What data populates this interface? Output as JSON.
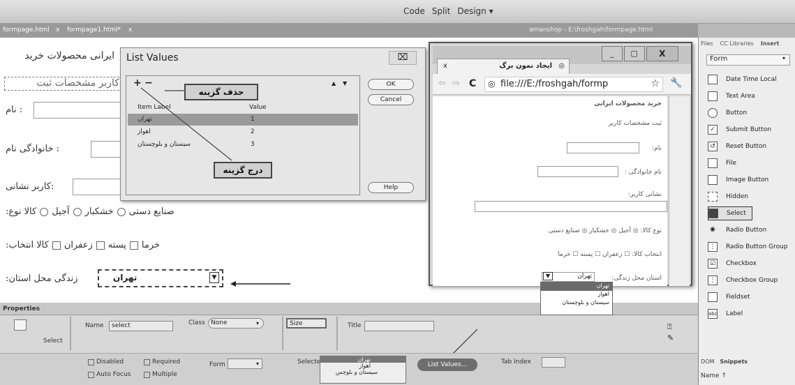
{
  "toolbar": {
    "code": "Code",
    "split": "Split",
    "design": "Design ▾"
  },
  "tabs": {
    "tab1": "formpage.html",
    "tab2": "formpage1.html*",
    "close": "x",
    "path": "amanshop - E:\\froshgah\\formpage.html"
  },
  "page": {
    "title": "ایرانی محصولات خرید",
    "subtitle": "کاربر مشخصات ثبت",
    "name_label": ": نام",
    "family_label": ": خانوادگی نام",
    "address_label": ":کاربر نشانی",
    "radio_label": ":کالا نوع",
    "radio_opts": [
      "آجیل",
      "خشکبار",
      "صنایع دستی"
    ],
    "check_label": ":کالا انتخاب",
    "check_opts": [
      "زعفران",
      "پسته",
      "خرما"
    ],
    "province_label": ":زندگی محل استان",
    "select_value": "تهران"
  },
  "dialog": {
    "title": "List Values",
    "close": "⌧",
    "plus": "+",
    "minus": "−",
    "up": "▲",
    "down": "▼",
    "col_label": "Item Label",
    "col_value": "Value",
    "rows": [
      {
        "label": "تهران",
        "value": "1"
      },
      {
        "label": "اهواز",
        "value": "2"
      },
      {
        "label": "سیستان و بلوچستان",
        "value": "3"
      }
    ],
    "ok": "OK",
    "cancel": "Cancel",
    "help": "Help"
  },
  "callouts": {
    "remove": "حذف گزینه",
    "insert": "درج گزینه"
  },
  "browser": {
    "tab_title": "ایجاد نمون برگ",
    "tab_close": "x",
    "url": "file:///E:/froshgah/formp",
    "title": "خرید محصولات ایرانی",
    "subtitle": "ثبت مشخصات کاربر",
    "name": "نام:",
    "family": "نام خانوادگی :",
    "address": "نشانی کاربر:",
    "kind": "نوع کالا: ◎ آجیل ◎ خشکبار ◎ صنایع دستی",
    "choose": "انتخاب کالا: ☐ زعفران ☐ پسته ☐ خرما",
    "province": "استان محل زندگی:",
    "select": "تهران",
    "opts": [
      "تهران",
      "اهواز",
      "سیستان و بلوچستان"
    ]
  },
  "insert_panel": {
    "tabs": [
      "Files",
      "CC Libraries",
      "Insert"
    ],
    "category": "Form",
    "items": [
      "Date Time Local",
      "Text Area",
      "Button",
      "Submit Button",
      "Reset Button",
      "File",
      "Image Button",
      "Hidden",
      "Select",
      "Radio Button",
      "Radio Button Group",
      "Checkbox",
      "Checkbox Group",
      "Fieldset",
      "Label"
    ],
    "bottom_tabs": [
      "DOM",
      "Snippets"
    ],
    "name_col": "Name ↑"
  },
  "properties": {
    "title": "Properties",
    "element": "Select",
    "name_label": "Name",
    "name_value": "select",
    "class_label": "Class",
    "class_value": "None",
    "size_label": "Size",
    "title_label": "Title",
    "disabled": "Disabled",
    "required": "Required",
    "auto_focus": "Auto Focus",
    "multiple": "Multiple",
    "form_label": "Form",
    "selected_label": "Selected",
    "selected_opts": [
      "تهران",
      "اهواز",
      "سیستان و بلوچس"
    ],
    "list_values_btn": "List Values...",
    "tab_index_label": "Tab Index"
  }
}
